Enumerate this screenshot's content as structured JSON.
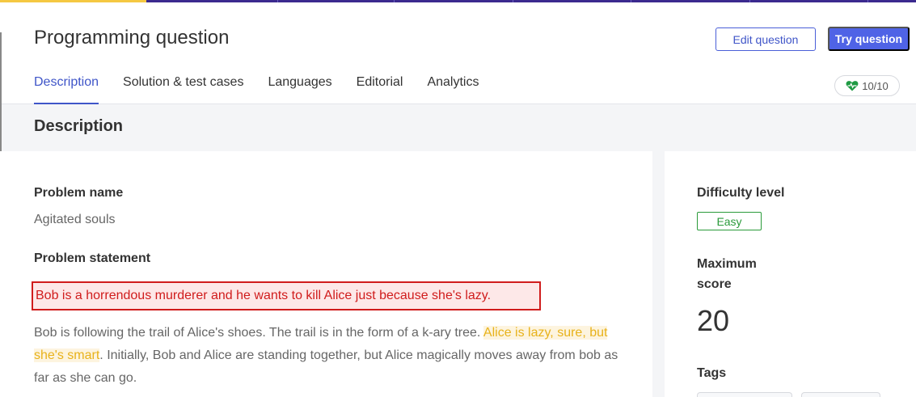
{
  "progress": {
    "fraction": 0.16
  },
  "header": {
    "title": "Programming question",
    "edit_label": "Edit question",
    "try_label": "Try question",
    "tabs": [
      {
        "label": "Description",
        "active": true
      },
      {
        "label": "Solution & test cases",
        "active": false
      },
      {
        "label": "Languages",
        "active": false
      },
      {
        "label": "Editorial",
        "active": false
      },
      {
        "label": "Analytics",
        "active": false
      }
    ],
    "health": {
      "icon": "heartbeat-icon",
      "value": "10/10",
      "color": "#1f9a43"
    }
  },
  "section": {
    "title": "Description"
  },
  "problem": {
    "name_label": "Problem name",
    "name_value": "Agitated souls",
    "statement_label": "Problem statement",
    "highlighted_sentence": "Bob is a horrendous murderer and he wants to kill Alice just because she's lazy.",
    "paragraph_part1": "Bob is following the trail of Alice's shoes. The trail is in the form of a k-ary tree. ",
    "paragraph_highlight": "Alice is lazy, sure, but she's smart",
    "paragraph_part2": ". Initially, Bob and Alice are standing together, but Alice magically moves away from bob as far as she can go."
  },
  "sidebar": {
    "difficulty_label": "Difficulty level",
    "difficulty_value": "Easy",
    "difficulty_color": "#2a9a3a",
    "max_score_label_line1": "Maximum",
    "max_score_label_line2": "score",
    "max_score_value": "20",
    "tags_label": "Tags"
  },
  "colors": {
    "accent": "#4f63e6",
    "highlight_red": "#d01c1c",
    "highlight_yellow": "#e8b21a"
  }
}
